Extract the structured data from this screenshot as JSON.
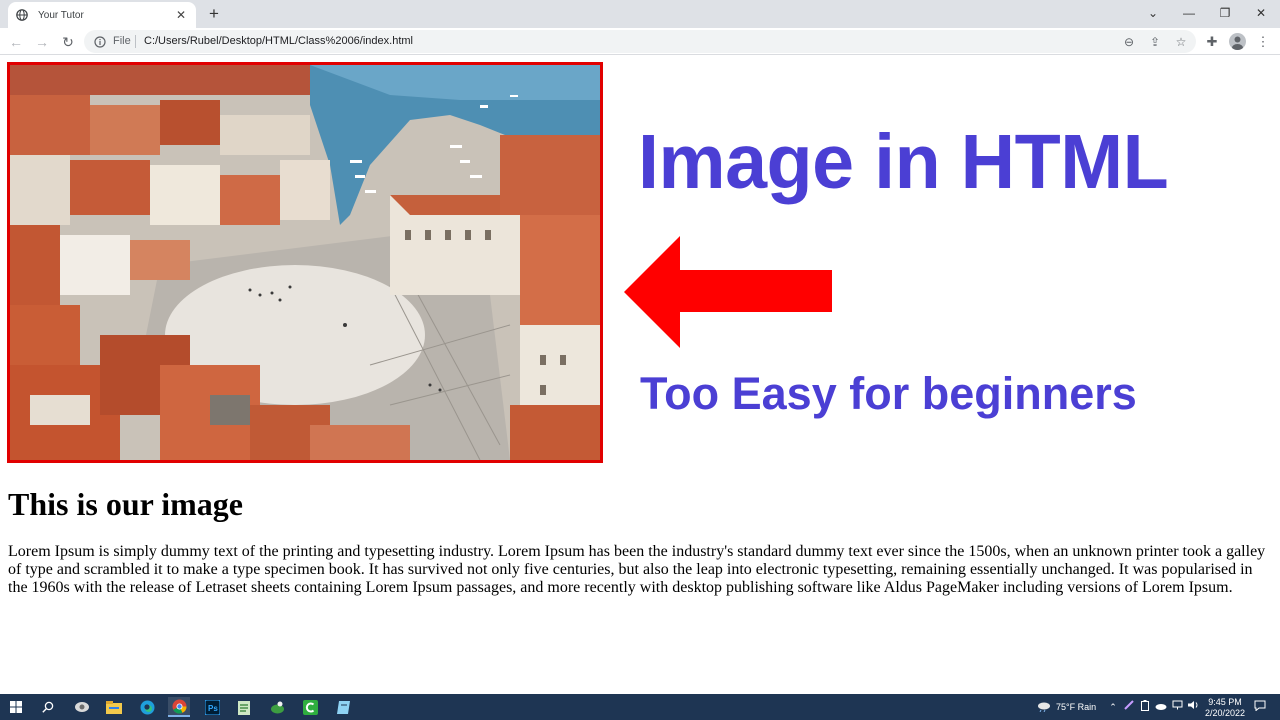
{
  "browser": {
    "tab": {
      "title": "Your Tutor",
      "close_glyph": "✕"
    },
    "new_tab_glyph": "+",
    "window_controls": {
      "tabsearch": "⌄",
      "minimize": "—",
      "restore": "❐",
      "close": "✕"
    },
    "nav": {
      "back": "←",
      "forward": "→",
      "reload": "↻"
    },
    "address": {
      "scheme_label": "File",
      "url": "C:/Users/Rubel/Desktop/HTML/Class%2006/index.html"
    },
    "icons": {
      "zoom": "⊖",
      "share": "⇪",
      "bookmark": "☆",
      "extensions": "✚",
      "menu": "⋮"
    }
  },
  "page": {
    "headline": "Image in HTML",
    "subline": "Too Easy for beginners",
    "heading": "This is our image",
    "paragraph": "Lorem Ipsum is simply dummy text of the printing and typesetting industry. Lorem Ipsum has been the industry's standard dummy text ever since the 1500s, when an unknown printer took a galley of type and scrambled it to make a type specimen book. It has survived not only five centuries, but also the leap into electronic typesetting, remaining essentially unchanged. It was popularised in the 1960s with the release of Letraset sheets containing Lorem Ipsum passages, and more recently with desktop publishing software like Aldus PageMaker including versions of Lorem Ipsum."
  },
  "colors": {
    "headline": "#4b3fd4",
    "arrow": "#ff0000",
    "image_border": "#e10000",
    "taskbar": "#1e3553"
  },
  "taskbar": {
    "weather": "75°F  Rain",
    "time": "9:45 PM",
    "date": "2/20/2022"
  }
}
